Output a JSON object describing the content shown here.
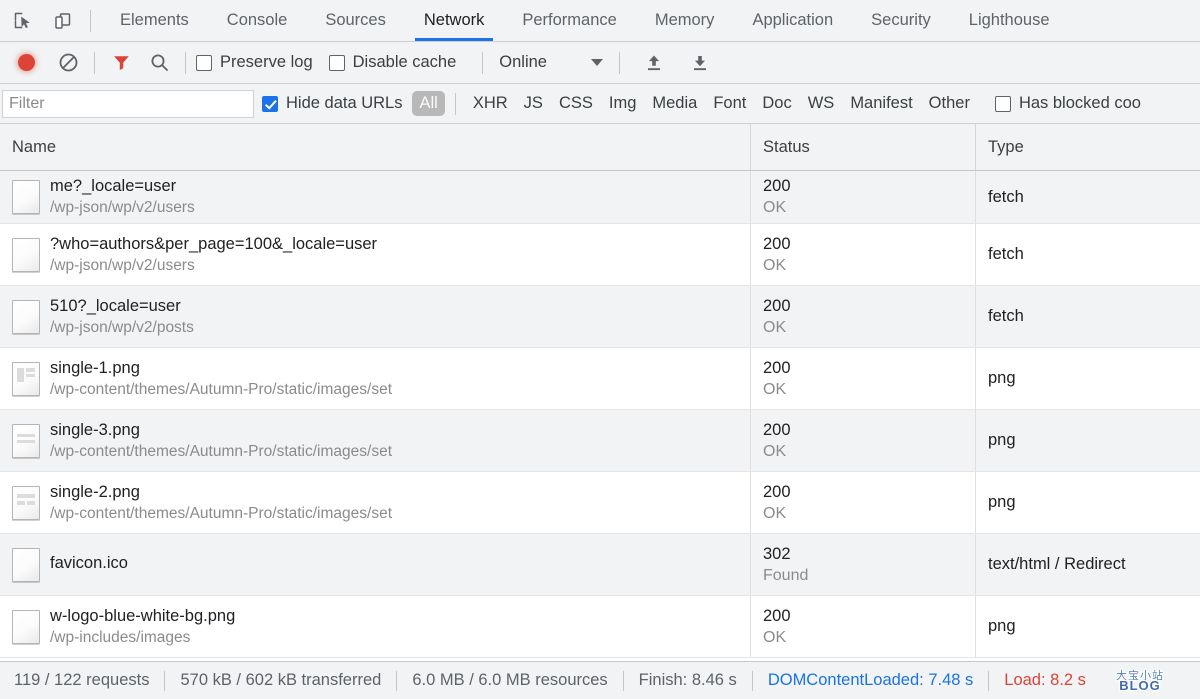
{
  "tabbar": {
    "inspect_icon": "inspect-element-icon",
    "device_icon": "device-toolbar-icon",
    "tabs": [
      {
        "label": "Elements",
        "active": false
      },
      {
        "label": "Console",
        "active": false
      },
      {
        "label": "Sources",
        "active": false
      },
      {
        "label": "Network",
        "active": true
      },
      {
        "label": "Performance",
        "active": false
      },
      {
        "label": "Memory",
        "active": false
      },
      {
        "label": "Application",
        "active": false
      },
      {
        "label": "Security",
        "active": false
      },
      {
        "label": "Lighthouse",
        "active": false
      }
    ]
  },
  "toolbar": {
    "record_icon": "record-button-icon",
    "clear_icon": "clear-icon",
    "filter_icon": "filter-funnel-icon",
    "search_icon": "search-icon",
    "preserve_log_label": "Preserve log",
    "preserve_log_checked": false,
    "disable_cache_label": "Disable cache",
    "disable_cache_checked": false,
    "throttling_value": "Online",
    "import_icon": "import-har-icon",
    "export_icon": "export-har-icon",
    "accent_color": "#1a73e8",
    "record_color": "#db4437"
  },
  "filterbar": {
    "filter_placeholder": "Filter",
    "filter_value": "",
    "hide_data_urls_label": "Hide data URLs",
    "hide_data_urls_checked": true,
    "types": [
      {
        "label": "All",
        "selected": true
      },
      {
        "label": "XHR",
        "selected": false
      },
      {
        "label": "JS",
        "selected": false
      },
      {
        "label": "CSS",
        "selected": false
      },
      {
        "label": "Img",
        "selected": false
      },
      {
        "label": "Media",
        "selected": false
      },
      {
        "label": "Font",
        "selected": false
      },
      {
        "label": "Doc",
        "selected": false
      },
      {
        "label": "WS",
        "selected": false
      },
      {
        "label": "Manifest",
        "selected": false
      },
      {
        "label": "Other",
        "selected": false
      }
    ],
    "has_blocked_cookies_label": "Has blocked coo",
    "has_blocked_cookies_checked": false
  },
  "table": {
    "columns": [
      {
        "key": "name",
        "label": "Name"
      },
      {
        "key": "status",
        "label": "Status"
      },
      {
        "key": "type",
        "label": "Type"
      }
    ],
    "rows": [
      {
        "name": "me?_locale=user",
        "path": "/wp-json/wp/v2/users",
        "status_code": "200",
        "status_text": "OK",
        "type": "fetch",
        "icon": "document-file-icon",
        "clipped": true
      },
      {
        "name": "?who=authors&per_page=100&_locale=user",
        "path": "/wp-json/wp/v2/users",
        "status_code": "200",
        "status_text": "OK",
        "type": "fetch",
        "icon": "document-file-icon",
        "clipped": false
      },
      {
        "name": "510?_locale=user",
        "path": "/wp-json/wp/v2/posts",
        "status_code": "200",
        "status_text": "OK",
        "type": "fetch",
        "icon": "document-file-icon",
        "clipped": false
      },
      {
        "name": "single-1.png",
        "path": "/wp-content/themes/Autumn-Pro/static/images/set",
        "status_code": "200",
        "status_text": "OK",
        "type": "png",
        "icon": "image-file-icon",
        "clipped": false
      },
      {
        "name": "single-3.png",
        "path": "/wp-content/themes/Autumn-Pro/static/images/set",
        "status_code": "200",
        "status_text": "OK",
        "type": "png",
        "icon": "image-file-icon",
        "clipped": false
      },
      {
        "name": "single-2.png",
        "path": "/wp-content/themes/Autumn-Pro/static/images/set",
        "status_code": "200",
        "status_text": "OK",
        "type": "png",
        "icon": "image-file-icon",
        "clipped": false
      },
      {
        "name": "favicon.ico",
        "path": "",
        "status_code": "302",
        "status_text": "Found",
        "type": "text/html / Redirect",
        "icon": "document-file-icon",
        "clipped": false
      },
      {
        "name": "w-logo-blue-white-bg.png",
        "path": "/wp-includes/images",
        "status_code": "200",
        "status_text": "OK",
        "type": "png",
        "icon": "document-file-icon",
        "clipped": false
      }
    ]
  },
  "footer": {
    "requests": "119 / 122 requests",
    "transferred": "570 kB / 602 kB transferred",
    "resources": "6.0 MB / 6.0 MB resources",
    "finish": "Finish: 8.46 s",
    "dom_content_loaded": "DOMContentLoaded: 7.48 s",
    "load": "Load: 8.2 s",
    "dcl_color": "#1a73e8",
    "load_color": "#db4437",
    "watermark_top": "大宝小站",
    "watermark_bottom": "BLOG"
  }
}
